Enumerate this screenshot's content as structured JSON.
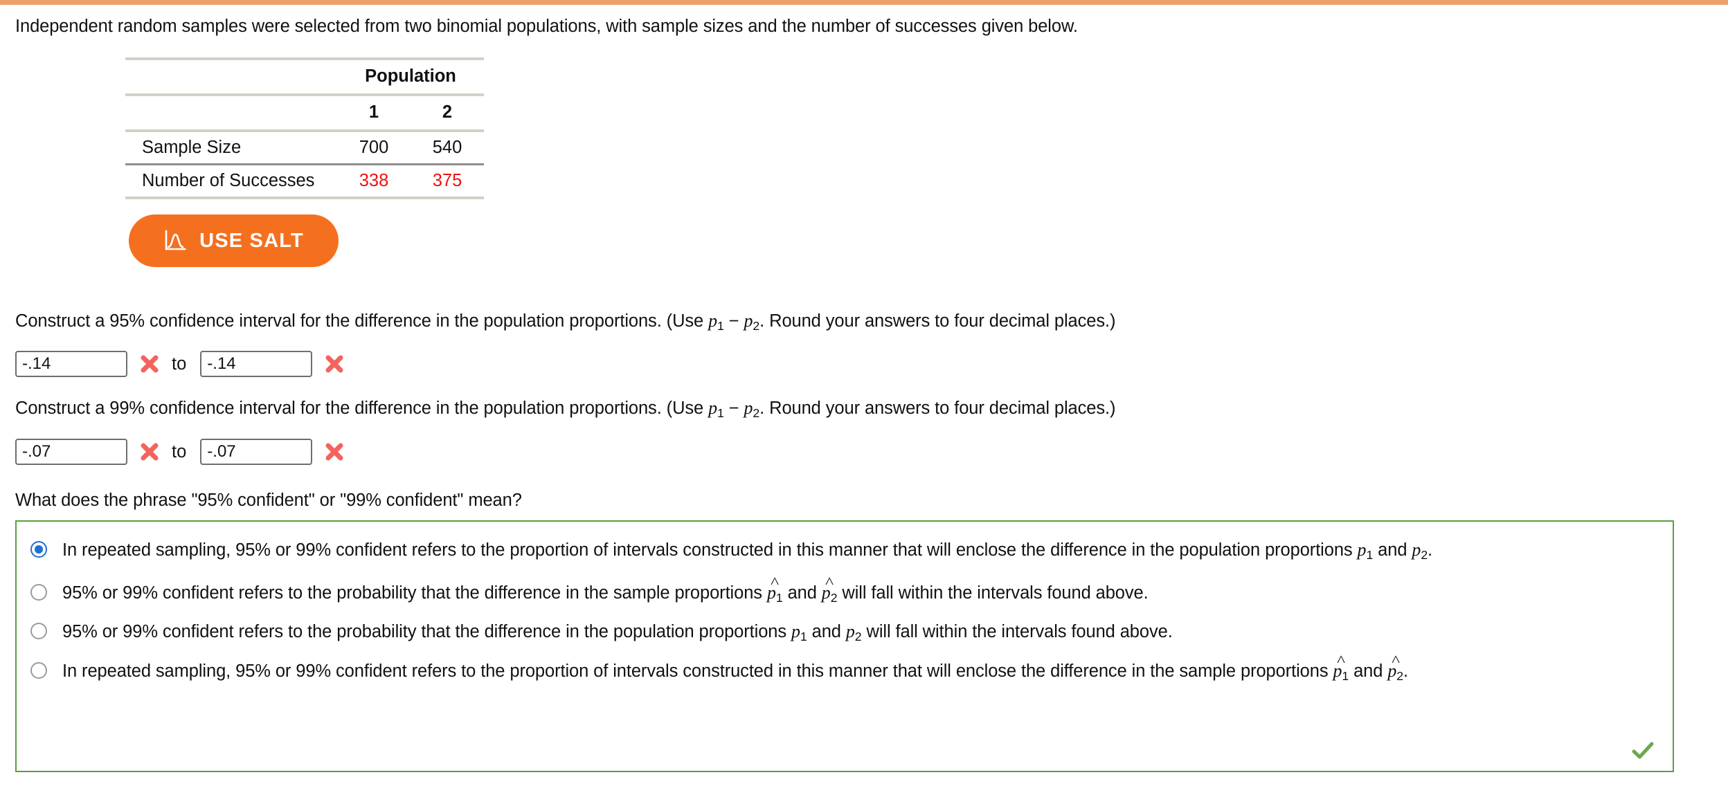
{
  "theme": {
    "accent_orange": "#eda16a",
    "salt_orange": "#f4701f",
    "correct_green": "#5a9e3f",
    "error_red": "#ee1111",
    "radio_blue": "#1b6fd6"
  },
  "intro": {
    "text": "Independent random samples were selected from two binomial populations, with sample sizes and the number of successes given below."
  },
  "table": {
    "group_header": "Population",
    "column_headers": [
      "1",
      "2"
    ],
    "rows": [
      {
        "label": "Sample Size",
        "values": [
          "700",
          "540"
        ],
        "highlight": false
      },
      {
        "label": "Number of Successes",
        "values": [
          "338",
          "375"
        ],
        "highlight": true
      }
    ]
  },
  "salt_button": {
    "label": "USE SALT",
    "icon": "normal-curve-icon"
  },
  "questions": [
    {
      "id": "ci95",
      "prompt_part1": "Construct a 95% confidence interval for the difference in the population proportions. (Use ",
      "math": "p1 - p2",
      "prompt_part2": ". Round your answers to four decimal places.)",
      "lower_value": "-.14",
      "upper_value": "-.14",
      "connector": "to",
      "lower_status": "incorrect",
      "upper_status": "incorrect"
    },
    {
      "id": "ci99",
      "prompt_part1": "Construct a 99% confidence interval for the difference in the population proportions. (Use ",
      "math": "p1 - p2",
      "prompt_part2": ". Round your answers to four decimal places.)",
      "lower_value": "-.07",
      "upper_value": "-.07",
      "connector": "to",
      "lower_status": "incorrect",
      "upper_status": "incorrect"
    }
  ],
  "multiple_choice": {
    "prompt": "What does the phrase \"95% confident\" or \"99% confident\" mean?",
    "status": "correct",
    "options": [
      {
        "selected": true,
        "text_a": "In repeated sampling, 95% or 99% confident refers to the proportion of intervals constructed in this manner that will enclose the difference in the population proportions ",
        "math_type": "p",
        "text_b": " and ",
        "text_c": "."
      },
      {
        "selected": false,
        "text_a": "95% or 99% confident refers to the probability that the difference in the sample proportions ",
        "math_type": "phat",
        "text_b": " and ",
        "text_c": " will fall within the intervals found above."
      },
      {
        "selected": false,
        "text_a": "95% or 99% confident refers to the probability that the difference in the population proportions ",
        "math_type": "p",
        "text_b": " and ",
        "text_c": " will fall within the intervals found above."
      },
      {
        "selected": false,
        "text_a": "In repeated sampling, 95% or 99% confident refers to the proportion of intervals constructed in this manner that will enclose the difference in the sample proportions ",
        "math_type": "phat",
        "text_b": " and ",
        "text_c": "."
      }
    ]
  }
}
